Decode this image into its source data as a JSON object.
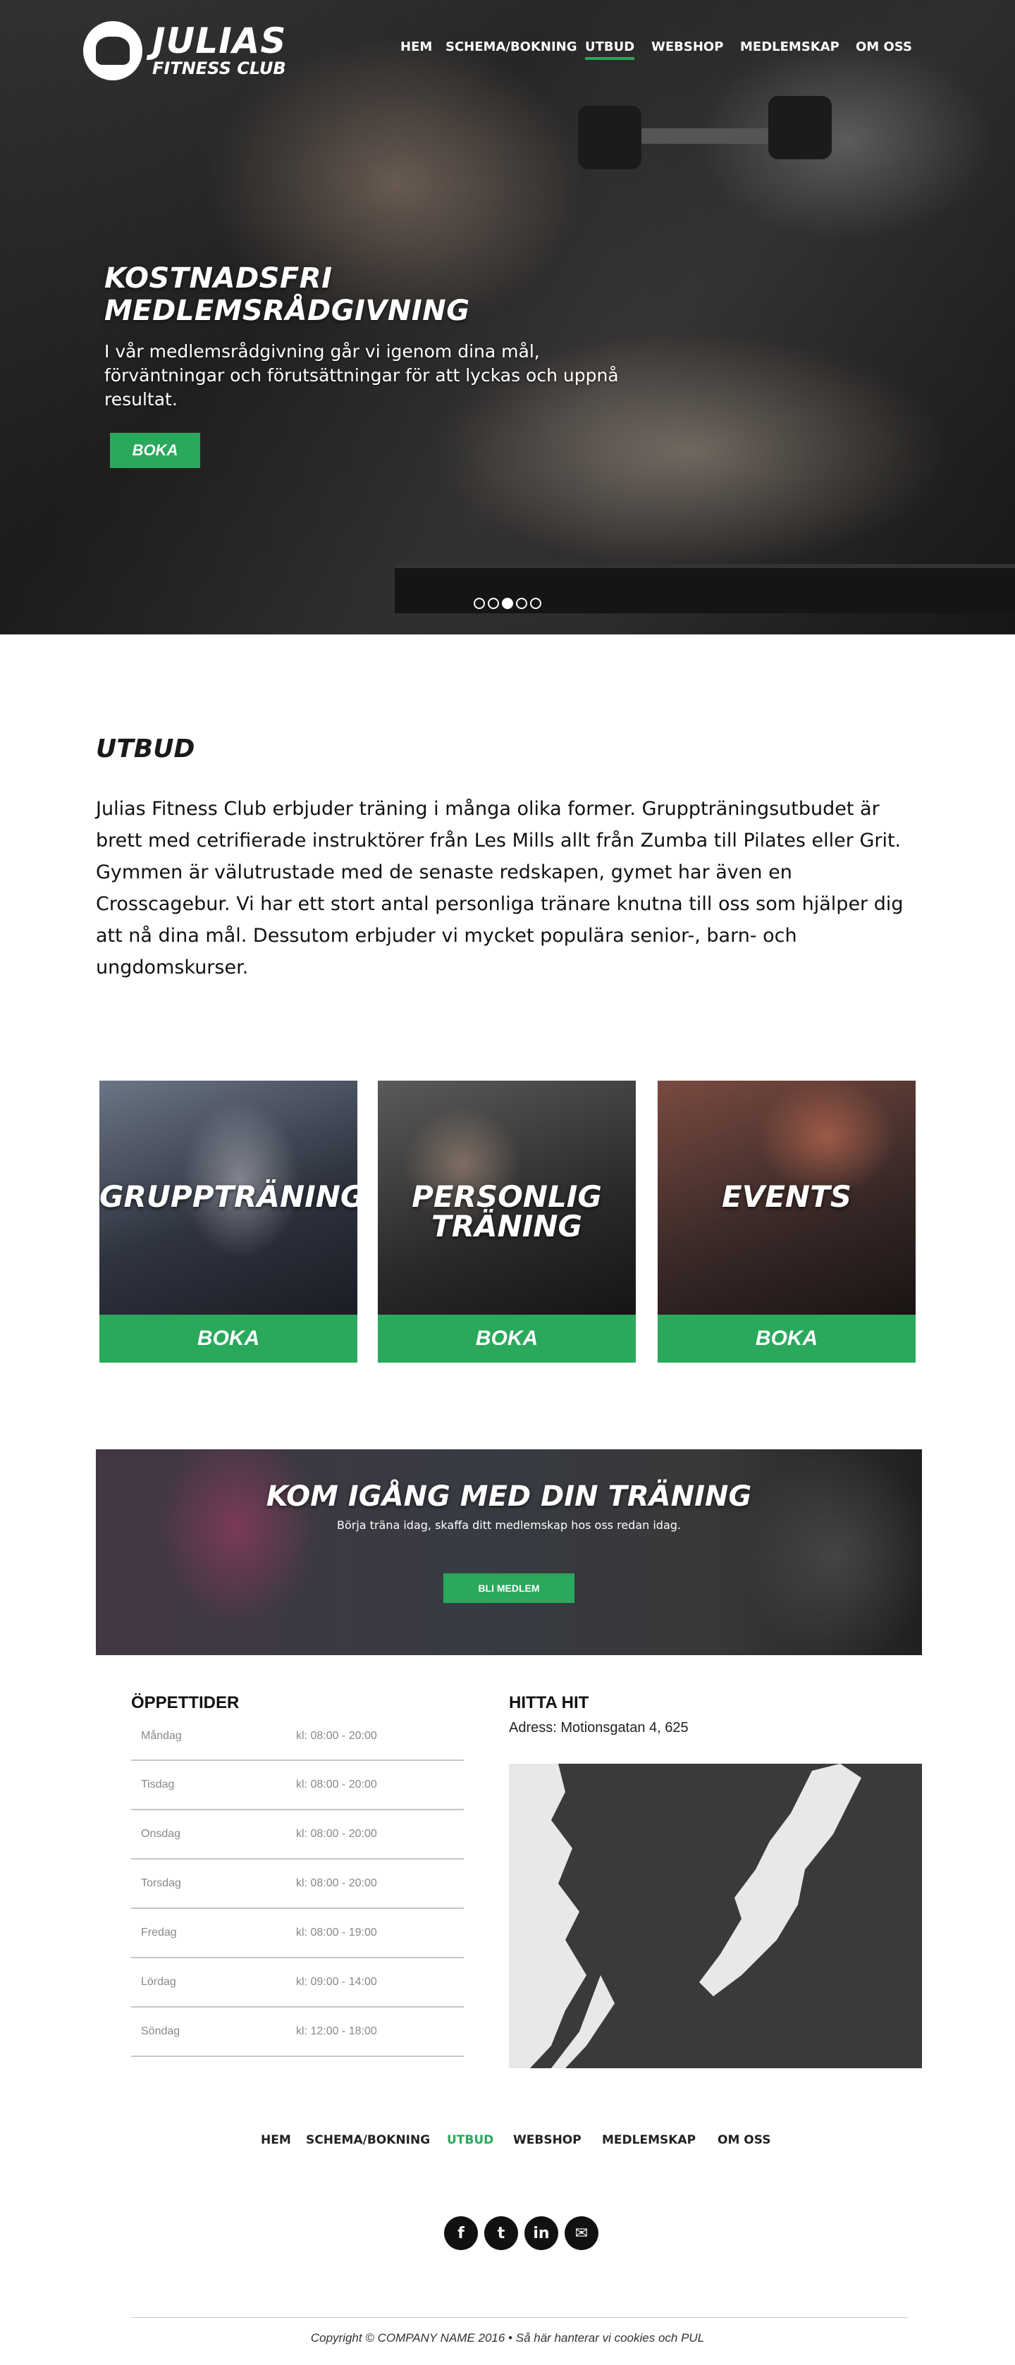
{
  "brand": {
    "name_line1": "JULIAS",
    "name_line2": "FITNESS CLUB"
  },
  "nav": {
    "items": [
      {
        "label": "HEM"
      },
      {
        "label": "SCHEMA/BOKNING"
      },
      {
        "label": "UTBUD"
      },
      {
        "label": "WEBSHOP"
      },
      {
        "label": "MEDLEMSKAP"
      },
      {
        "label": "OM OSS"
      }
    ],
    "active": "UTBUD"
  },
  "hero": {
    "title": "KOSTNADSFRI MEDLEMSRÅDGIVNING",
    "text": " I vår medlemsrådgivning går vi igenom dina mål, förväntningar och förutsättningar för att lyckas och uppnå resultat.",
    "button": "BOKA",
    "slides": 5,
    "active_slide": 3
  },
  "intro": {
    "heading": "UTBUD",
    "body": "Julias Fitness Club erbjuder träning i många olika former. Gruppträningsutbudet är brett med cetrifierade instruktörer från Les Mills allt från Zumba till Pilates eller Grit. Gymmen är välutrustade med de senaste redskapen, gymet har även en Crosscagebur. Vi har ett stort antal personliga tränare knutna till oss som hjälper dig att nå dina mål. Dessutom erbjuder vi mycket populära senior-, barn- och ungdomskurser."
  },
  "cards": [
    {
      "title_line1": "GRUPPTRÄNING",
      "title_line2": "",
      "button": "BOKA"
    },
    {
      "title_line1": "PERSONLIG",
      "title_line2": "TRÄNING",
      "button": "BOKA"
    },
    {
      "title_line1": "EVENTS",
      "title_line2": "",
      "button": "BOKA"
    }
  ],
  "cta": {
    "title": "KOM IGÅNG MED DIN TRÄNING",
    "subtitle": "Börja träna idag, skaffa ditt medlemskap hos oss redan idag.",
    "button": "BLI MEDLEM"
  },
  "hours": {
    "heading": "ÖPPETTIDER",
    "rows": [
      {
        "day": "Måndag",
        "time": "kl: 08:00 - 20:00"
      },
      {
        "day": "Tisdag",
        "time": "kl: 08:00 - 20:00"
      },
      {
        "day": "Onsdag",
        "time": "kl: 08:00 - 20:00"
      },
      {
        "day": "Torsdag",
        "time": "kl: 08:00 - 20:00"
      },
      {
        "day": "Fredag",
        "time": "kl: 08:00 - 19:00"
      },
      {
        "day": "Lördag",
        "time": "kl: 09:00 - 14:00"
      },
      {
        "day": "Söndag",
        "time": "kl: 12:00 - 18:00"
      }
    ]
  },
  "location": {
    "heading": "HITTA HIT",
    "address": "Adress: Motionsgatan 4, 625"
  },
  "footer": {
    "nav": [
      {
        "label": "HEM"
      },
      {
        "label": "SCHEMA/BOKNING"
      },
      {
        "label": "UTBUD"
      },
      {
        "label": "WEBSHOP"
      },
      {
        "label": "MEDLEMSKAP"
      },
      {
        "label": "OM OSS"
      }
    ],
    "social": [
      {
        "name": "facebook-icon",
        "glyph": "f"
      },
      {
        "name": "twitter-icon",
        "glyph": "t"
      },
      {
        "name": "linkedin-icon",
        "glyph": "in"
      },
      {
        "name": "email-icon",
        "glyph": "✉"
      }
    ],
    "copyright": "Copyright © COMPANY NAME 2016 • Så här hanterar vi cookies och PUL"
  },
  "colors": {
    "accent": "#2aa85c",
    "text": "#111111",
    "map_bg": "#3a3a3a"
  }
}
